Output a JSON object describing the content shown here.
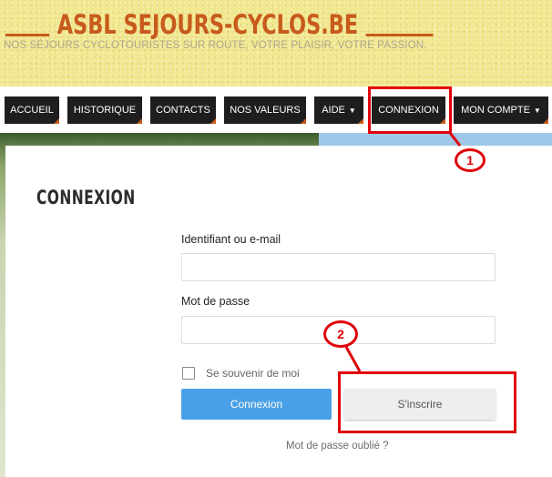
{
  "site": {
    "title": "ASBL SEJOURS-CYCLOS.BE",
    "tagline": "NOS SÉJOURS CYCLOTOURISTES SUR ROUTE, VOTRE PLAISIR, VOTRE PASSION."
  },
  "nav": {
    "items": [
      {
        "label": "ACCUEIL"
      },
      {
        "label": "HISTORIQUE"
      },
      {
        "label": "CONTACTS"
      },
      {
        "label": "NOS VALEURS"
      },
      {
        "label": "AIDE",
        "has_dropdown": true
      },
      {
        "label": "CONNEXION",
        "active": true
      },
      {
        "label": "MON COMPTE",
        "has_dropdown": true
      }
    ]
  },
  "annotations": {
    "marker_1": "1",
    "marker_2": "2"
  },
  "login": {
    "title": "CONNEXION",
    "username_label": "Identifiant ou e-mail",
    "username_value": "",
    "password_label": "Mot de passe",
    "password_value": "",
    "remember_label": "Se souvenir de moi",
    "remember_checked": false,
    "login_button": "Connexion",
    "register_button": "S'inscrire",
    "forgot_link": "Mot de passe oublié ?"
  },
  "colors": {
    "accent": "#c75a1c",
    "header_bg": "#f1e78e",
    "nav_bg": "#1e1e1e",
    "primary_button": "#4aa0e6",
    "annotation_red": "#e0000a"
  },
  "icons": {
    "dropdown": "chevron-down-icon",
    "checkbox": "checkbox-icon"
  }
}
